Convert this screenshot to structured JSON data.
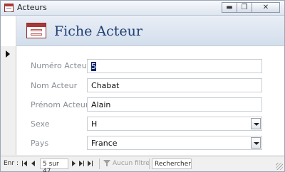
{
  "window": {
    "title": "Acteurs",
    "controls": {
      "minimize": "▬",
      "restore": "❐",
      "close": "✕"
    }
  },
  "form": {
    "header_title": "Fiche Acteur",
    "fields": [
      {
        "label": "Numéro Acteur",
        "value": "5",
        "selected": true
      },
      {
        "label": "Nom Acteur",
        "value": "Chabat"
      },
      {
        "label": "Prénom Acteur",
        "value": "Alain"
      },
      {
        "label": "Sexe",
        "value": "H",
        "type": "combo"
      },
      {
        "label": "Pays",
        "value": "France",
        "type": "combo"
      }
    ]
  },
  "navigation": {
    "prefix": "Enr :",
    "record_position": "5 sur 47",
    "filter_label": "Aucun filtre",
    "search_placeholder": "Rechercher"
  },
  "icons": {
    "app": "access-form-icon",
    "header": "form-icon",
    "record_marker": "current-record-arrow-icon",
    "filter": "filter-icon"
  },
  "colors": {
    "header_title": "#1f3f73",
    "header_band": "#d3deec",
    "label": "#8a8f96",
    "selection": "#0a246a"
  }
}
